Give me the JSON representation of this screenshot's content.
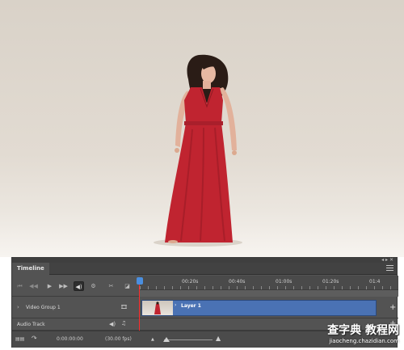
{
  "timeline": {
    "tab_label": "Timeline",
    "panel_controls": "◂ ▸ ✕",
    "transport": {
      "first_frame_icon": "⏮",
      "prev_frame_icon": "◀◀",
      "play_icon": "▶",
      "next_frame_icon": "▶▶",
      "audio_icon": "◀)",
      "settings_icon": "⚙",
      "split_icon": "✂",
      "transition_icon": "◪"
    },
    "ruler_ticks": [
      "00:20s",
      "00:40s",
      "01:00s",
      "01:20s",
      "01:4"
    ],
    "tracks": {
      "video_group": {
        "label": "Video Group 1",
        "chevron": "›",
        "film_icon": "🎞",
        "clip_label": "Layer 1",
        "clip_chevron": "›",
        "add": "+"
      },
      "audio": {
        "label": "Audio Track",
        "speaker_icon": "◀)",
        "note_icon": "♫",
        "add": "+"
      }
    },
    "footer": {
      "render_icon": "▤▤",
      "convert_icon": "↷",
      "current_time": "0:00:00:00",
      "fps": "(30.00 fps)",
      "zoom_small_icon": "▲",
      "zoom_large_icon": "▲"
    }
  },
  "photo": {
    "subject": "woman in red dress"
  },
  "watermark": {
    "main": "查字典 教程网",
    "sub": "jiaocheng.chazidian.com"
  },
  "colors": {
    "panel_bg": "#535353",
    "clip_blue": "#4a72b4",
    "playhead": "#ff2a2a",
    "dress_red": "#c02430"
  }
}
